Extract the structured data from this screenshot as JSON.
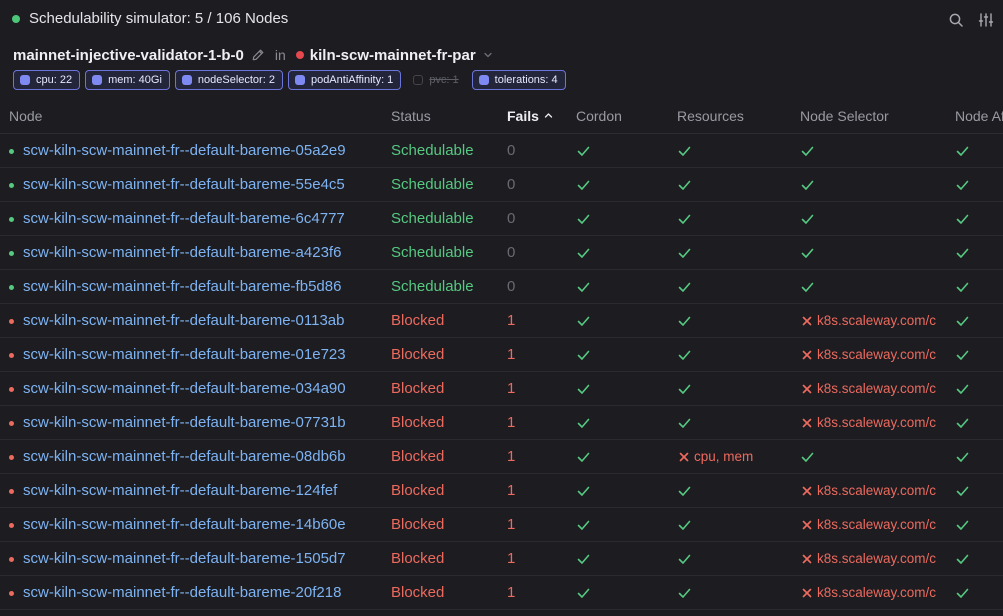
{
  "header": {
    "title": "Schedulability simulator: 5 / 106 Nodes",
    "title_dot_color": "#4cc77a",
    "icons": [
      "search-icon",
      "sliders-icon"
    ]
  },
  "context": {
    "pod": "mainnet-injective-validator-1-b-0",
    "in_word": "in",
    "cluster": "kiln-scw-mainnet-fr-par",
    "cluster_dot_color": "#e5484d"
  },
  "chips": [
    {
      "label": "cpu: 22",
      "active": true
    },
    {
      "label": "mem: 40Gi",
      "active": true
    },
    {
      "label": "nodeSelector: 2",
      "active": true
    },
    {
      "label": "podAntiAffinity: 1",
      "active": true
    },
    {
      "label": "pvc: 1",
      "active": false
    },
    {
      "label": "tolerations: 4",
      "active": true
    }
  ],
  "table": {
    "columns": [
      "Node",
      "Status",
      "Fails",
      "Cordon",
      "Resources",
      "Node Selector",
      "Node Affinity"
    ],
    "sorted_column": "Fails",
    "sort_direction": "ascending",
    "rows": [
      {
        "node": "scw-kiln-scw-mainnet-fr--default-bareme-05a2e9",
        "status": "Schedulable",
        "fails": "0",
        "cordon": "ok",
        "resources": "ok",
        "node_selector": "ok",
        "node_selector_reason": "",
        "resources_reason": "",
        "node_affinity": "ok"
      },
      {
        "node": "scw-kiln-scw-mainnet-fr--default-bareme-55e4c5",
        "status": "Schedulable",
        "fails": "0",
        "cordon": "ok",
        "resources": "ok",
        "node_selector": "ok",
        "node_selector_reason": "",
        "resources_reason": "",
        "node_affinity": "ok"
      },
      {
        "node": "scw-kiln-scw-mainnet-fr--default-bareme-6c4777",
        "status": "Schedulable",
        "fails": "0",
        "cordon": "ok",
        "resources": "ok",
        "node_selector": "ok",
        "node_selector_reason": "",
        "resources_reason": "",
        "node_affinity": "ok"
      },
      {
        "node": "scw-kiln-scw-mainnet-fr--default-bareme-a423f6",
        "status": "Schedulable",
        "fails": "0",
        "cordon": "ok",
        "resources": "ok",
        "node_selector": "ok",
        "node_selector_reason": "",
        "resources_reason": "",
        "node_affinity": "ok"
      },
      {
        "node": "scw-kiln-scw-mainnet-fr--default-bareme-fb5d86",
        "status": "Schedulable",
        "fails": "0",
        "cordon": "ok",
        "resources": "ok",
        "node_selector": "ok",
        "node_selector_reason": "",
        "resources_reason": "",
        "node_affinity": "ok"
      },
      {
        "node": "scw-kiln-scw-mainnet-fr--default-bareme-0113ab",
        "status": "Blocked",
        "fails": "1",
        "cordon": "ok",
        "resources": "ok",
        "node_selector": "fail",
        "node_selector_reason": "k8s.scaleway.com/c",
        "resources_reason": "",
        "node_affinity": "ok"
      },
      {
        "node": "scw-kiln-scw-mainnet-fr--default-bareme-01e723",
        "status": "Blocked",
        "fails": "1",
        "cordon": "ok",
        "resources": "ok",
        "node_selector": "fail",
        "node_selector_reason": "k8s.scaleway.com/c",
        "resources_reason": "",
        "node_affinity": "ok"
      },
      {
        "node": "scw-kiln-scw-mainnet-fr--default-bareme-034a90",
        "status": "Blocked",
        "fails": "1",
        "cordon": "ok",
        "resources": "ok",
        "node_selector": "fail",
        "node_selector_reason": "k8s.scaleway.com/c",
        "resources_reason": "",
        "node_affinity": "ok"
      },
      {
        "node": "scw-kiln-scw-mainnet-fr--default-bareme-07731b",
        "status": "Blocked",
        "fails": "1",
        "cordon": "ok",
        "resources": "ok",
        "node_selector": "fail",
        "node_selector_reason": "k8s.scaleway.com/c",
        "resources_reason": "",
        "node_affinity": "ok"
      },
      {
        "node": "scw-kiln-scw-mainnet-fr--default-bareme-08db6b",
        "status": "Blocked",
        "fails": "1",
        "cordon": "ok",
        "resources": "fail",
        "node_selector": "ok",
        "node_selector_reason": "",
        "resources_reason": "cpu, mem",
        "node_affinity": "ok"
      },
      {
        "node": "scw-kiln-scw-mainnet-fr--default-bareme-124fef",
        "status": "Blocked",
        "fails": "1",
        "cordon": "ok",
        "resources": "ok",
        "node_selector": "fail",
        "node_selector_reason": "k8s.scaleway.com/c",
        "resources_reason": "",
        "node_affinity": "ok"
      },
      {
        "node": "scw-kiln-scw-mainnet-fr--default-bareme-14b60e",
        "status": "Blocked",
        "fails": "1",
        "cordon": "ok",
        "resources": "ok",
        "node_selector": "fail",
        "node_selector_reason": "k8s.scaleway.com/c",
        "resources_reason": "",
        "node_affinity": "ok"
      },
      {
        "node": "scw-kiln-scw-mainnet-fr--default-bareme-1505d7",
        "status": "Blocked",
        "fails": "1",
        "cordon": "ok",
        "resources": "ok",
        "node_selector": "fail",
        "node_selector_reason": "k8s.scaleway.com/c",
        "resources_reason": "",
        "node_affinity": "ok"
      },
      {
        "node": "scw-kiln-scw-mainnet-fr--default-bareme-20f218",
        "status": "Blocked",
        "fails": "1",
        "cordon": "ok",
        "resources": "ok",
        "node_selector": "fail",
        "node_selector_reason": "k8s.scaleway.com/c",
        "resources_reason": "",
        "node_affinity": "ok"
      }
    ]
  },
  "colors": {
    "ok": "#56c981",
    "fail": "#ec6a5e",
    "link": "#7eb3f2",
    "accent": "#7f89f2"
  }
}
